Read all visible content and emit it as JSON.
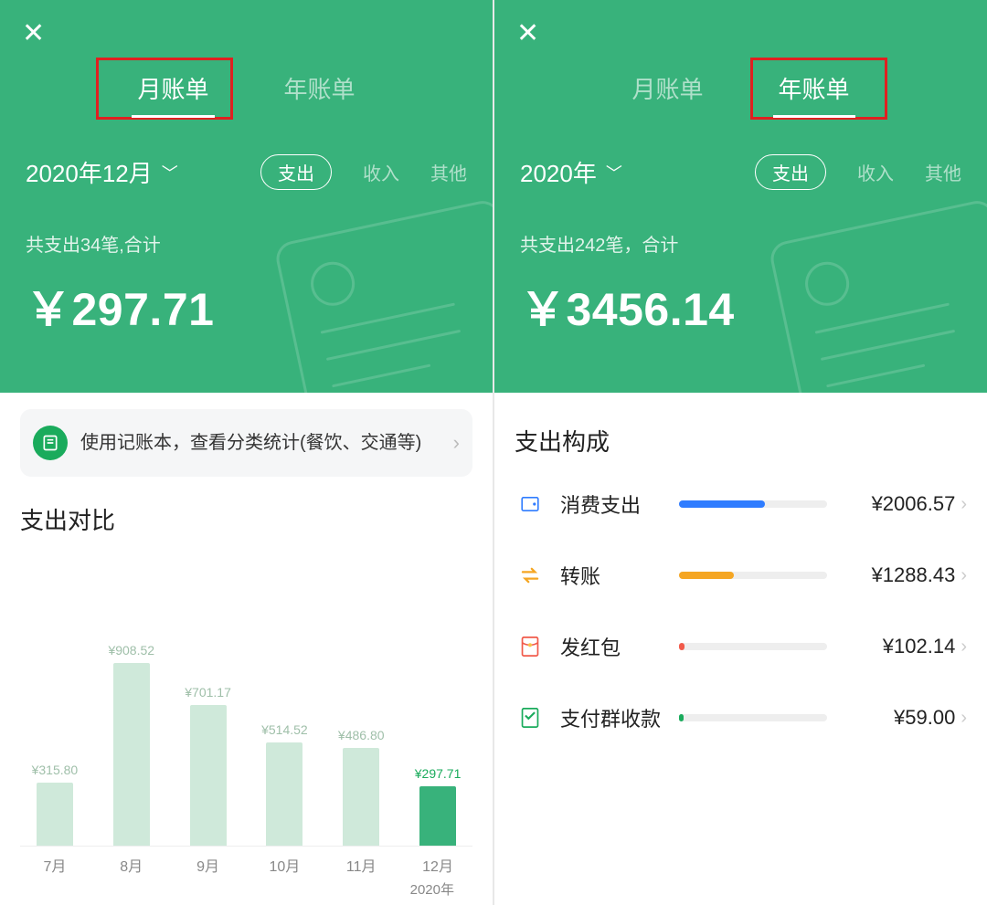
{
  "left": {
    "tabs": {
      "monthly": "月账单",
      "yearly": "年账单"
    },
    "period": "2020年12月",
    "pills": {
      "expense": "支出",
      "income": "收入",
      "other": "其他"
    },
    "summary_sub": "共支出34笔,合计",
    "summary_amount": "￥297.71",
    "promo_text": "使用记账本，查看分类统计(餐饮、交通等)",
    "section_title": "支出对比",
    "axis_year": "2020年"
  },
  "right": {
    "tabs": {
      "monthly": "月账单",
      "yearly": "年账单"
    },
    "period": "2020年",
    "pills": {
      "expense": "支出",
      "income": "收入",
      "other": "其他"
    },
    "summary_sub": "共支出242笔，合计",
    "summary_amount": "￥3456.14",
    "section_title": "支出构成",
    "composition": [
      {
        "name": "消费支出",
        "amount": "¥2006.57",
        "color": "#2f7cff",
        "pct": 58,
        "icon": "wallet"
      },
      {
        "name": "转账",
        "amount": "¥1288.43",
        "color": "#f5a623",
        "pct": 37,
        "icon": "transfer"
      },
      {
        "name": "发红包",
        "amount": "¥102.14",
        "color": "#f15a4a",
        "pct": 4,
        "icon": "hongbao"
      },
      {
        "name": "支付群收款",
        "amount": "¥59.00",
        "color": "#1aab5c",
        "pct": 3,
        "icon": "group"
      }
    ]
  },
  "chart_data": {
    "type": "bar",
    "title": "支出对比",
    "xlabel": "",
    "ylabel": "",
    "categories": [
      "7月",
      "8月",
      "9月",
      "10月",
      "11月",
      "12月"
    ],
    "values": [
      315.8,
      908.52,
      701.17,
      514.52,
      486.8,
      297.71
    ],
    "value_labels": [
      "¥315.80",
      "¥908.52",
      "¥701.17",
      "¥514.52",
      "¥486.80",
      "¥297.71"
    ],
    "highlight_index": 5,
    "ylim": [
      0,
      1000
    ],
    "year_label": "2020年"
  }
}
